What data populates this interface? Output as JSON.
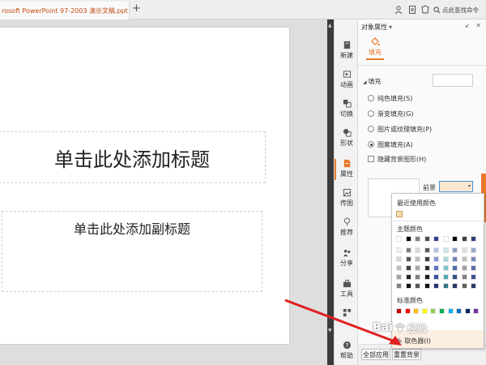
{
  "tabbar": {
    "doc_title": "rosoft PowerPoint 97-2003 演示文稿.ppt *",
    "close_glyph": "×",
    "new_tab_glyph": "+",
    "search_label": "点此查找命令"
  },
  "slide": {
    "title_placeholder": "单击此处添加标题",
    "subtitle_placeholder": "单击此处添加副标题"
  },
  "rail": {
    "items": [
      {
        "label": "新建",
        "icon": "new-slide-icon"
      },
      {
        "label": "动画",
        "icon": "animation-icon"
      },
      {
        "label": "切换",
        "icon": "transition-icon"
      },
      {
        "label": "形状",
        "icon": "shape-icon"
      },
      {
        "label": "属性",
        "icon": "properties-icon",
        "active": true
      },
      {
        "label": "传图",
        "icon": "upload-image-icon"
      },
      {
        "label": "推荐",
        "icon": "recommend-icon"
      },
      {
        "label": "分享",
        "icon": "share-icon"
      },
      {
        "label": "工具",
        "icon": "tools-icon"
      },
      {
        "label": "帮助",
        "icon": "help-icon"
      }
    ]
  },
  "pane": {
    "header": "对象属性",
    "header_dropdown_glyph": "▾",
    "fill_tab": "填充",
    "section_fill": "填充",
    "options": [
      {
        "label": "纯色填充(S)",
        "type": "radio",
        "checked": false
      },
      {
        "label": "渐变填充(G)",
        "type": "radio",
        "checked": false
      },
      {
        "label": "图片或纹理填充(P)",
        "type": "radio",
        "checked": false
      },
      {
        "label": "图案填充(A)",
        "type": "radio",
        "checked": true
      },
      {
        "label": "隐藏背景图形(H)",
        "type": "checkbox",
        "checked": false
      }
    ],
    "foreground_label": "前景",
    "apply_all_button": "全部应用",
    "reset_background_button": "重置背景"
  },
  "color_popup": {
    "recent_label": "最近使用颜色",
    "theme_label": "主题颜色",
    "standard_label": "标准颜色",
    "eyedropper_label": "取色器(I)",
    "recent_color": "#f5deb0",
    "theme_base": [
      "#ffffff",
      "#000000",
      "#808080",
      "#4d4d4d",
      "#2e3f8f",
      "#ffffff",
      "#000000",
      "#404040",
      "#2c3e7a"
    ],
    "theme_tints": [
      [
        "#f2f2f2",
        "#7f7f7f",
        "#d9d9d9",
        "#5a5a5a",
        "#b8c4e8",
        "#cde8ea",
        "#8fa0c8",
        "#e0e0e0",
        "#9aa7d0"
      ],
      [
        "#d9d9d9",
        "#595959",
        "#bfbfbf",
        "#3f3f3f",
        "#8898d4",
        "#a8d8dc",
        "#6f84b8",
        "#c0c0c0",
        "#7a89c0"
      ],
      [
        "#bfbfbf",
        "#404040",
        "#a6a6a6",
        "#2e2e2e",
        "#5e74c4",
        "#7ac4cc",
        "#4f68a8",
        "#a0a0a0",
        "#5a6cb0"
      ],
      [
        "#a6a6a6",
        "#262626",
        "#808080",
        "#1f1f1f",
        "#3a4fa0",
        "#4ea8b2",
        "#36508a",
        "#808080",
        "#3f5296"
      ],
      [
        "#7f7f7f",
        "#0d0d0d",
        "#595959",
        "#101010",
        "#263570",
        "#2e7a84",
        "#243866",
        "#606060",
        "#2a386a"
      ]
    ],
    "standard": [
      "#c00000",
      "#ff0000",
      "#ffc000",
      "#ffff00",
      "#92d050",
      "#00b050",
      "#00b0f0",
      "#0070c0",
      "#002060",
      "#7030a0"
    ]
  },
  "watermark": {
    "logo": "Bai",
    "text": "经验"
  },
  "colors": {
    "accent": "#e8792b",
    "annotation_arrow": "#e02020",
    "focus_blue": "#4a8fd8"
  }
}
